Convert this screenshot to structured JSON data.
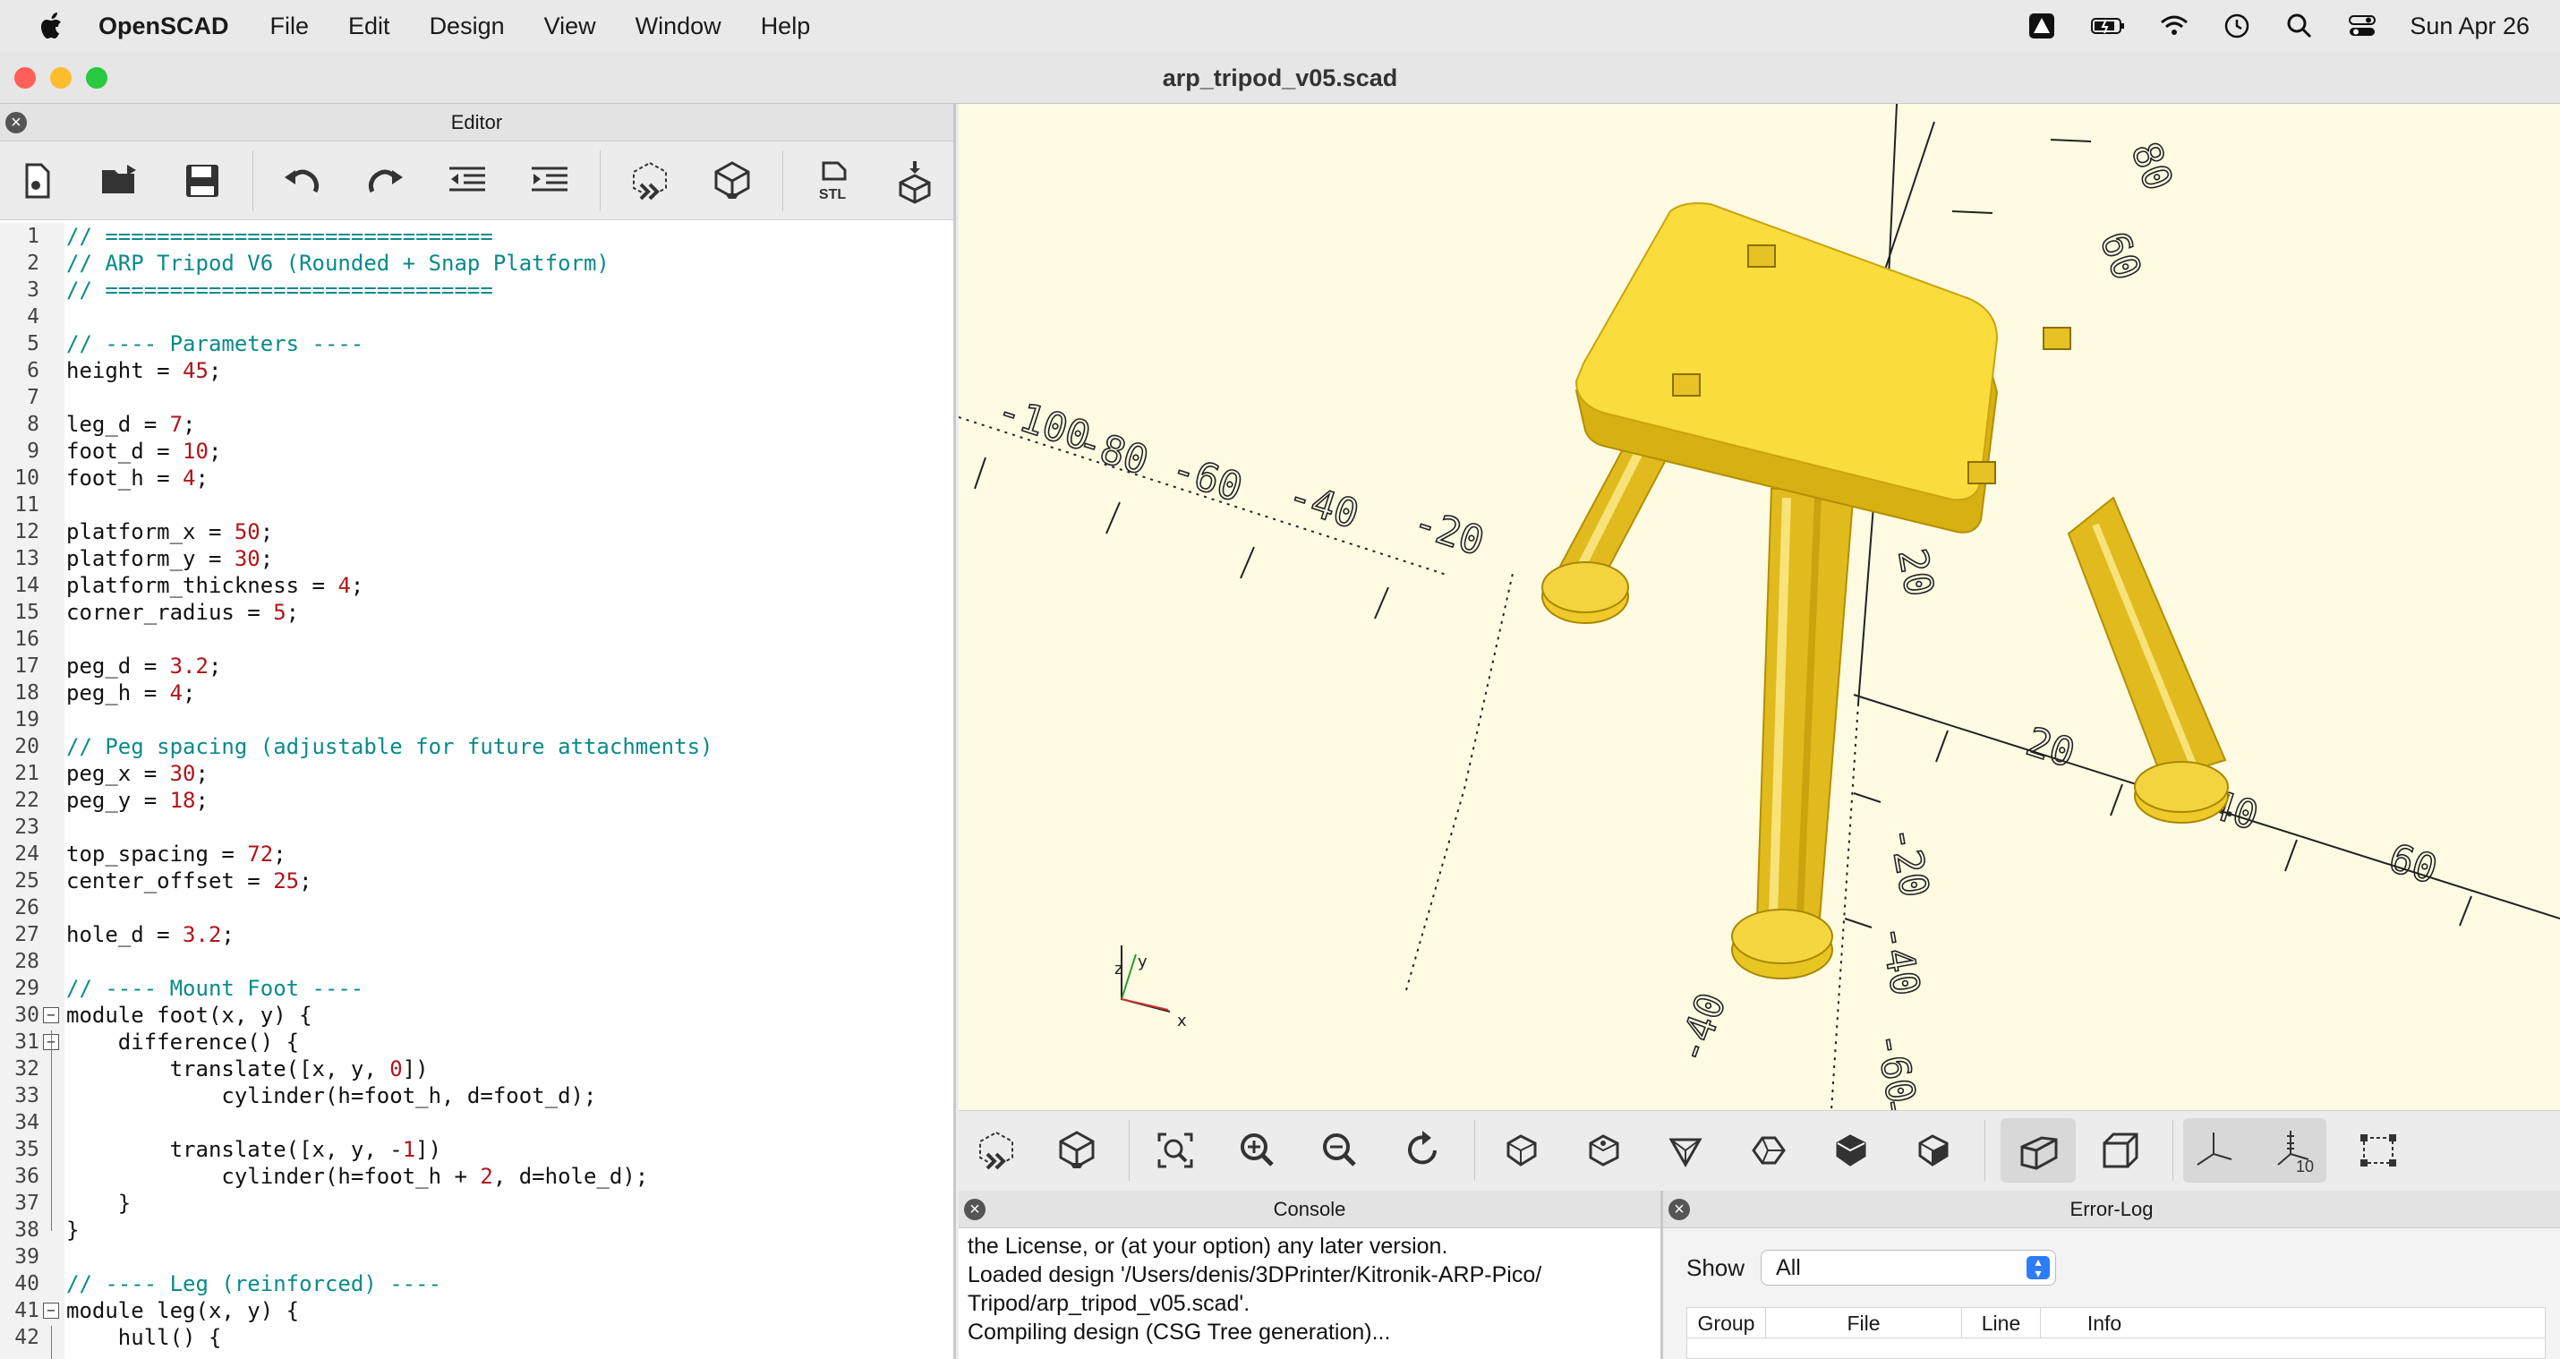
{
  "menubar": {
    "app": "OpenSCAD",
    "items": [
      "File",
      "Edit",
      "Design",
      "View",
      "Window",
      "Help"
    ],
    "date": "Sun Apr 26"
  },
  "window": {
    "title": "arp_tripod_v05.scad"
  },
  "editor": {
    "title": "Editor",
    "toolbar": [
      "new-file-icon",
      "open-file-icon",
      "save-icon",
      "undo-icon",
      "redo-icon",
      "unindent-icon",
      "indent-icon",
      "preview-icon",
      "render-icon",
      "export-stl-icon",
      "send-to-printer-icon"
    ],
    "stl_label": "STL",
    "lines": [
      "// ==============================",
      "// ARP Tripod V6 (Rounded + Snap Platform)",
      "// ==============================",
      "",
      "// ---- Parameters ----",
      "height = 45;",
      "",
      "leg_d = 7;",
      "foot_d = 10;",
      "foot_h = 4;",
      "",
      "platform_x = 50;",
      "platform_y = 30;",
      "platform_thickness = 4;",
      "corner_radius = 5;",
      "",
      "peg_d = 3.2;",
      "peg_h = 4;",
      "",
      "// Peg spacing (adjustable for future attachments)",
      "peg_x = 30;",
      "peg_y = 18;",
      "",
      "top_spacing = 72;",
      "center_offset = 25;",
      "",
      "hole_d = 3.2;",
      "",
      "// ---- Mount Foot ----",
      "module foot(x, y) {",
      "    difference() {",
      "        translate([x, y, 0])",
      "            cylinder(h=foot_h, d=foot_d);",
      "",
      "        translate([x, y, -1])",
      "            cylinder(h=foot_h + 2, d=hole_d);",
      "    }",
      "}",
      "",
      "// ---- Leg (reinforced) ----",
      "module leg(x, y) {",
      "    hull() {"
    ]
  },
  "viewport": {
    "axis_labels": [
      "-100",
      "-80",
      "-60",
      "-40",
      "-20",
      "20",
      "40",
      "60",
      "80",
      "60",
      "40",
      "20",
      "-20",
      "-40",
      "-60",
      "-80",
      "-40"
    ],
    "gizmo": [
      "z",
      "y",
      "x"
    ],
    "toolbar": [
      "preview-icon",
      "render-icon",
      "view-all-icon",
      "zoom-in-icon",
      "zoom-out-icon",
      "reset-view-icon",
      "view-right-icon",
      "view-top-icon",
      "view-bottom-icon",
      "view-left-icon",
      "view-front-icon",
      "view-back-icon",
      "perspective-icon",
      "orthogonal-icon",
      "show-axes-icon",
      "show-scale-markers-icon",
      "show-edges-icon"
    ],
    "scale_label": "10",
    "colors": {
      "background": "#fffbe3",
      "model": "#f7d43a",
      "model_dark": "#c9a40e"
    }
  },
  "console": {
    "title": "Console",
    "lines": [
      "the License, or (at your option) any later version.",
      "",
      "Loaded design '/Users/denis/3DPrinter/Kitronik-ARP-Pico/",
      "Tripod/arp_tripod_v05.scad'.",
      "Compiling design (CSG Tree generation)..."
    ]
  },
  "errorlog": {
    "title": "Error-Log",
    "show_label": "Show",
    "filter_value": "All",
    "columns": [
      "Group",
      "File",
      "Line",
      "Info"
    ]
  }
}
